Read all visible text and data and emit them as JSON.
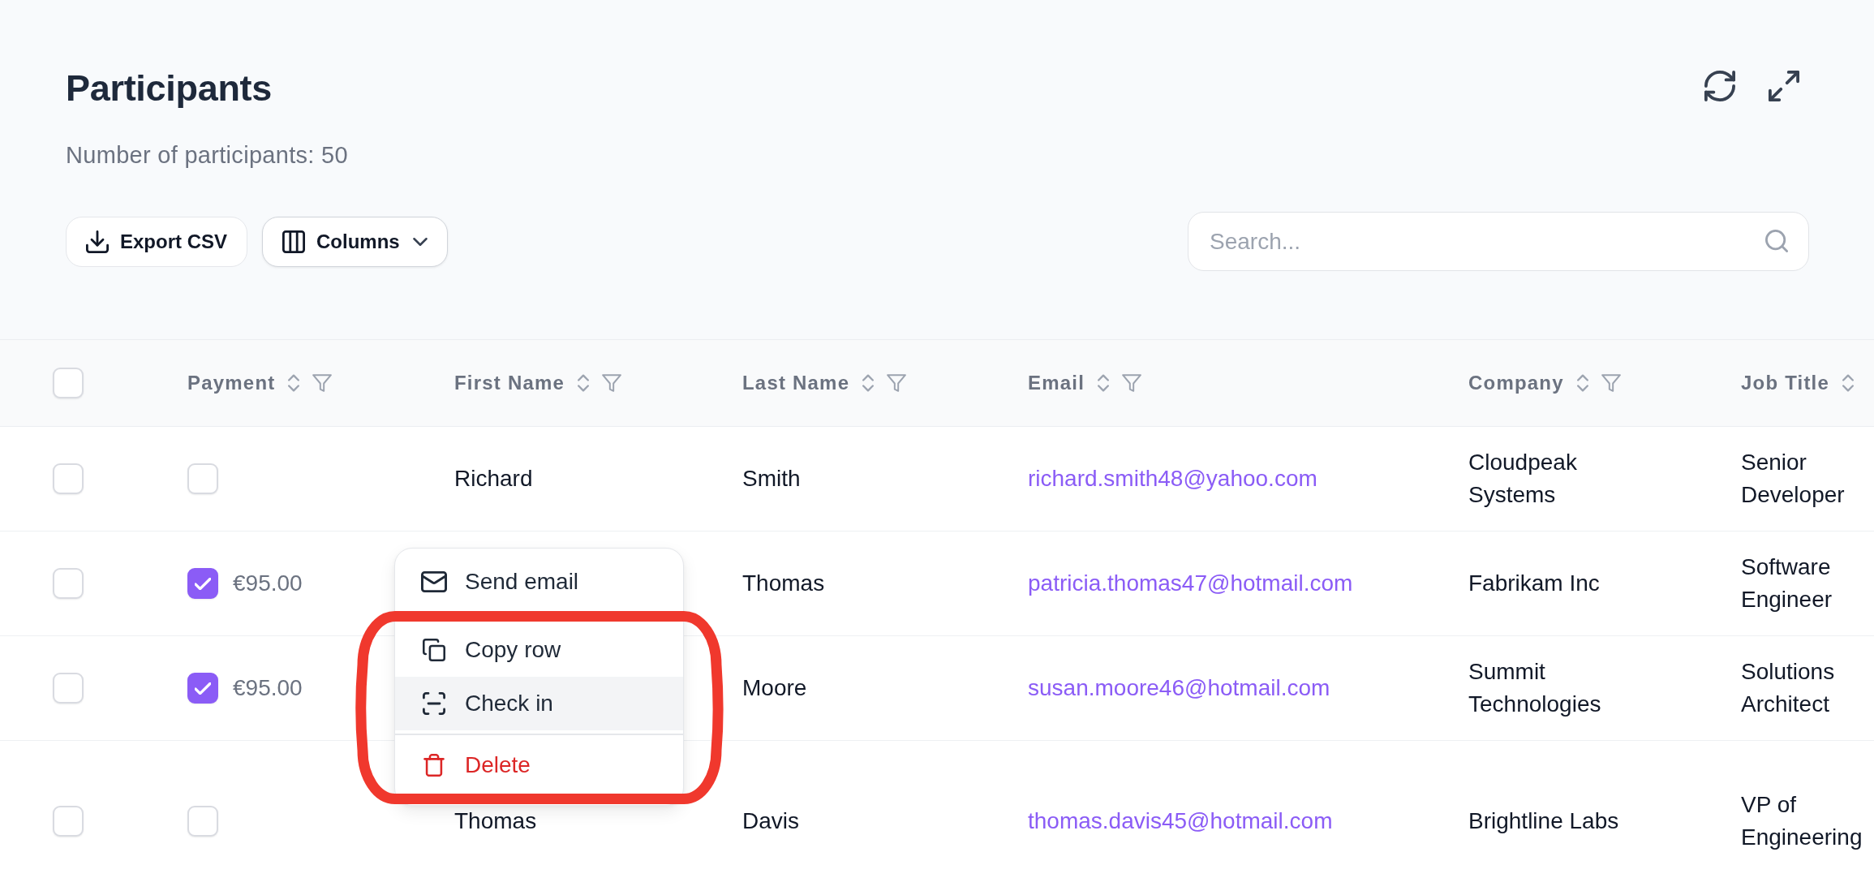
{
  "page": {
    "title": "Participants",
    "subtitle": "Number of participants: 50"
  },
  "toolbar": {
    "buttons": [
      {
        "label": "Export CSV",
        "kind": "export"
      },
      {
        "label": "Columns",
        "kind": "dropdown"
      }
    ],
    "search": {
      "placeholder": "Search..."
    }
  },
  "table": {
    "select_all": {
      "checked": false
    },
    "columns": [
      {
        "label": "Payment",
        "sortable": true,
        "filterable": true
      },
      {
        "label": "First Name",
        "sortable": true,
        "filterable": true
      },
      {
        "label": "Last Name",
        "sortable": true,
        "filterable": true
      },
      {
        "label": "Email",
        "sortable": true,
        "filterable": true
      },
      {
        "label": "Company",
        "sortable": true,
        "filterable": true
      },
      {
        "label": "Job Title",
        "sortable": true,
        "filterable": false
      }
    ],
    "rows": [
      {
        "selected": false,
        "paid": false,
        "first_name": "Richard",
        "last_name": "Smith",
        "email": "richard.smith48@yahoo.com",
        "company": "Cloudpeak Systems",
        "job_title": "Senior Developer"
      },
      {
        "selected": false,
        "paid": true,
        "payment": "€95.00",
        "last_name": "Thomas",
        "email": "patricia.thomas47@hotmail.com",
        "company": "Fabrikam Inc",
        "job_title": "Software Engineer"
      },
      {
        "selected": false,
        "paid": true,
        "payment": "€95.00",
        "last_name": "Moore",
        "email": "susan.moore46@hotmail.com",
        "company": "Summit Technologies",
        "job_title": "Solutions Architect"
      },
      {
        "selected": false,
        "paid": false,
        "first_name": "Thomas",
        "last_name": "Davis",
        "email": "thomas.davis45@hotmail.com",
        "company": "Brightline Labs",
        "job_title": "VP of Engineering"
      }
    ]
  },
  "context_menu": {
    "items": [
      {
        "label": "Send email",
        "kind": "action",
        "highlighted": false
      },
      {
        "label": "Copy row",
        "kind": "action",
        "highlighted": false
      },
      {
        "label": "Check in",
        "kind": "action",
        "highlighted": true
      },
      {
        "label": "Delete",
        "kind": "danger",
        "highlighted": false
      }
    ]
  }
}
